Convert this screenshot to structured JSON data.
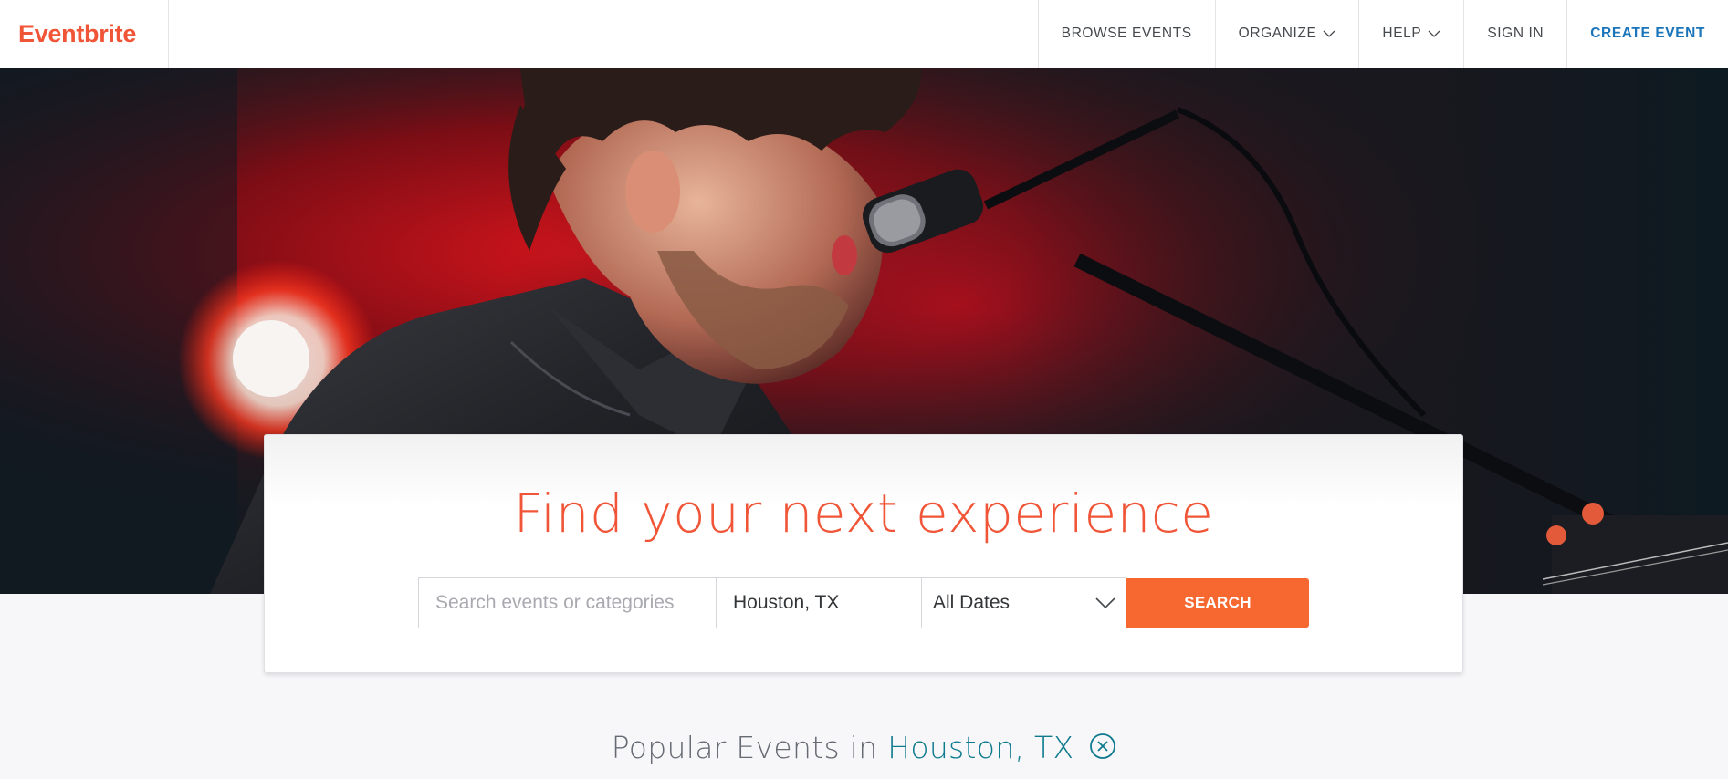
{
  "header": {
    "logo": "Eventbrite",
    "nav": {
      "browse": "BROWSE EVENTS",
      "organize": "ORGANIZE",
      "help": "HELP",
      "sign_in": "SIGN IN",
      "create": "CREATE EVENT"
    }
  },
  "hero": {
    "image_subject": "singer-at-microphone-photo"
  },
  "search": {
    "headline": "Find your next experience",
    "keyword_placeholder": "Search events or categories",
    "location_value": "Houston, TX",
    "dates_selected": "All Dates",
    "button_label": "SEARCH"
  },
  "popular": {
    "prefix": "Popular Events in",
    "city": "Houston, TX"
  },
  "colors": {
    "brand": "#f05537",
    "search_button": "#f6682f",
    "link_blue": "#1b75bb",
    "city_teal": "#0f7b8e"
  }
}
